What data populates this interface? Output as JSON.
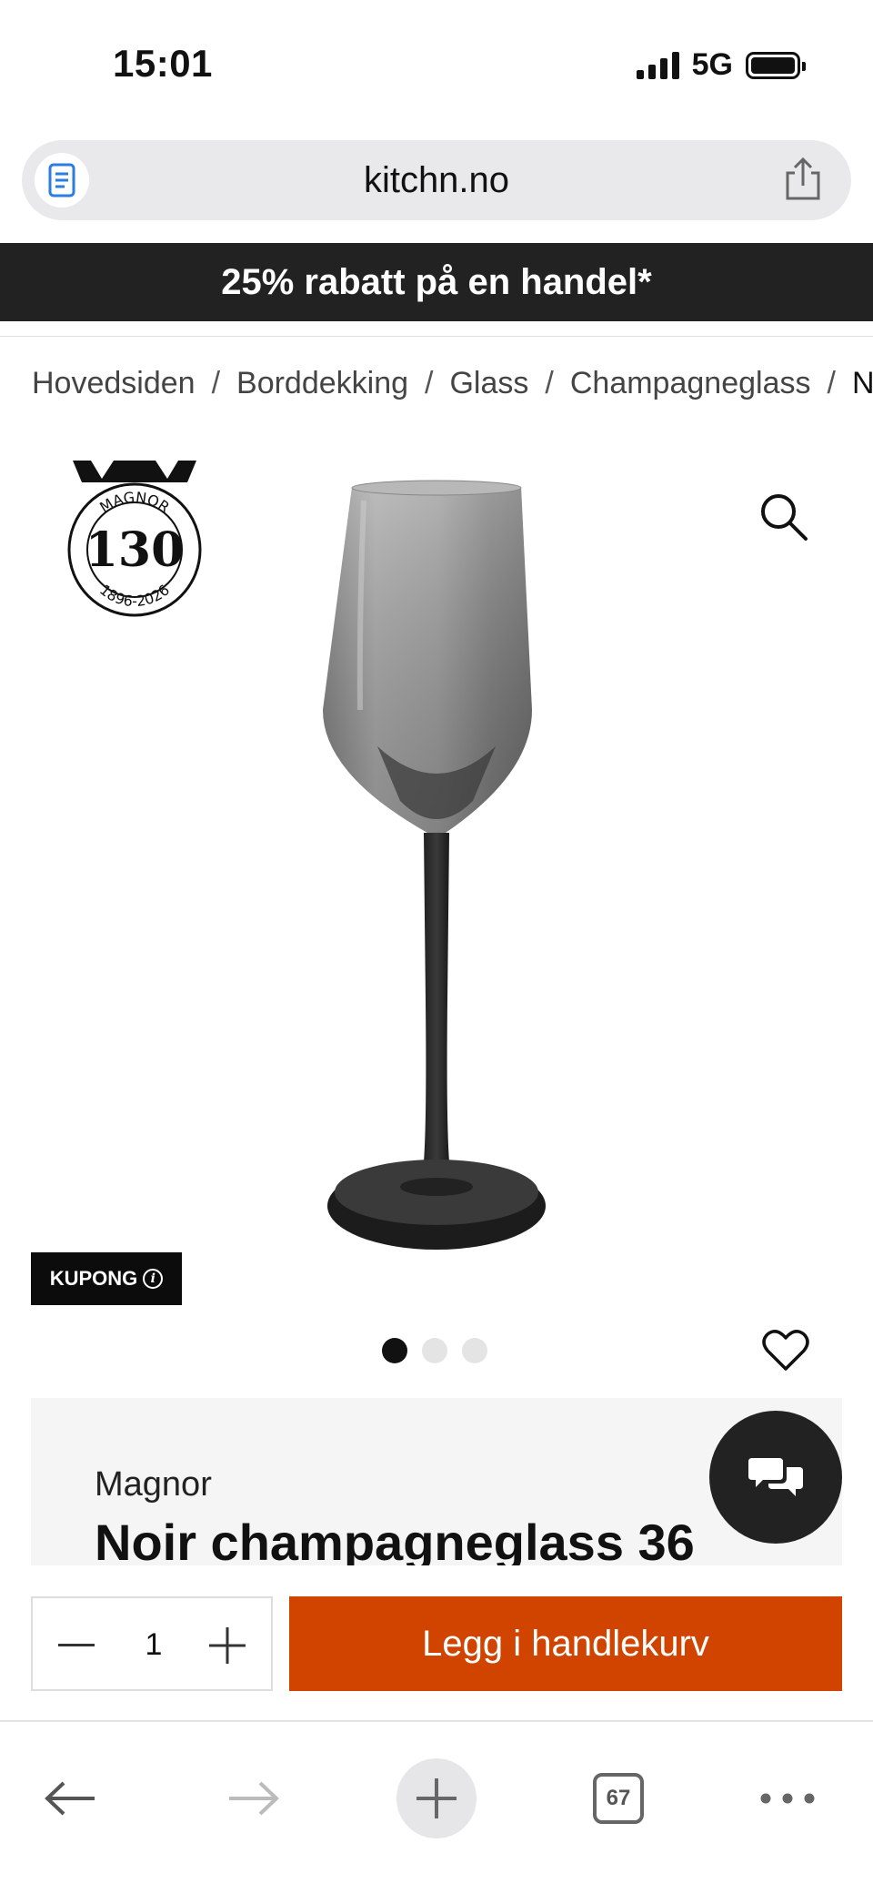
{
  "status_bar": {
    "time": "15:01",
    "network": "5G"
  },
  "browser": {
    "url": "kitchn.no",
    "tab_count": "67"
  },
  "promo": {
    "text": "25% rabatt på en handel*"
  },
  "breadcrumb": {
    "items": [
      "Hovedsiden",
      "Borddekking",
      "Glass",
      "Champagneglass"
    ],
    "current": "N",
    "separator": "/"
  },
  "logo": {
    "brand": "MAGNOR",
    "number": "130",
    "years": "1896-2026"
  },
  "product": {
    "coupon_label": "KUPONG",
    "coupon_info_icon": "i",
    "brand": "Magnor",
    "title": "Noir champagneglass 36",
    "image_count": 3,
    "active_image": 1
  },
  "cart": {
    "quantity": "1",
    "add_label": "Legg i handlekurv",
    "accent_color": "#d04400"
  },
  "icons": {
    "reader": "reader-icon",
    "share": "share-icon",
    "zoom": "search-icon",
    "favorite": "heart-icon",
    "chat": "chat-icon",
    "back": "arrow-left-icon",
    "forward": "arrow-right-icon",
    "new_tab": "plus-icon",
    "tabs": "tabs-icon",
    "more": "more-icon"
  }
}
